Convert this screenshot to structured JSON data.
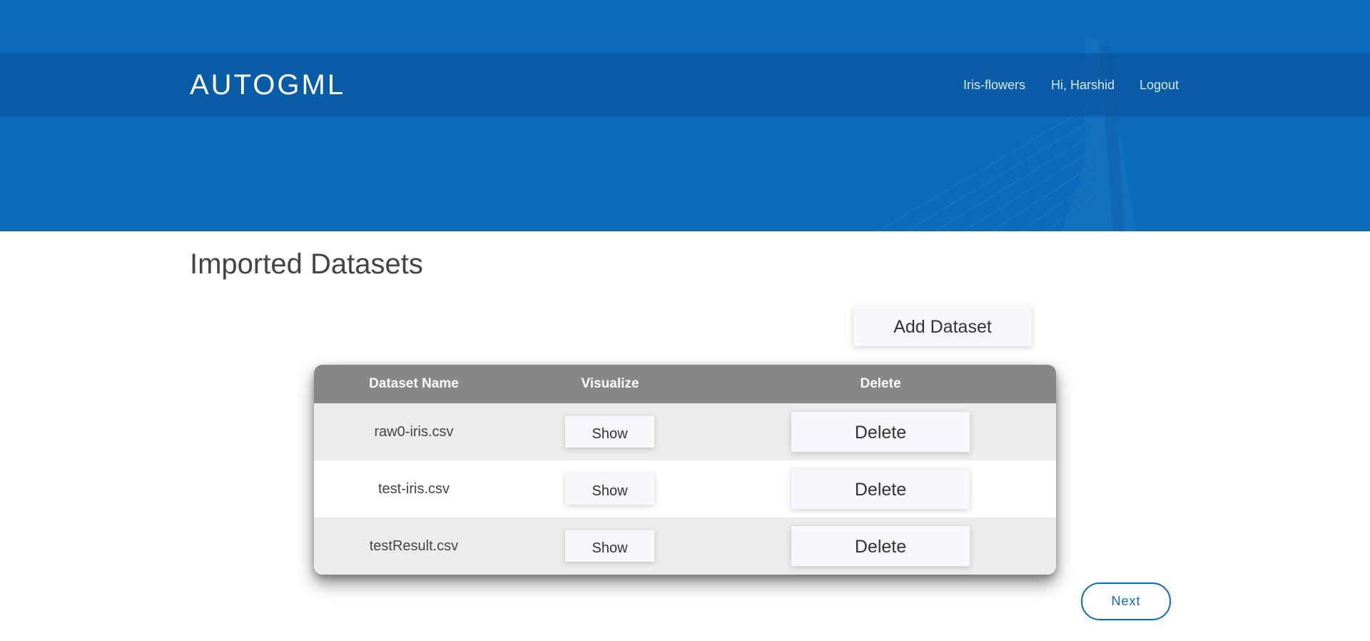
{
  "header": {
    "brand": "AUTOGML",
    "nav": [
      {
        "label": "Iris-flowers"
      },
      {
        "label": "Hi, Harshid"
      },
      {
        "label": "Logout"
      }
    ]
  },
  "main": {
    "title": "Imported Datasets",
    "add_button": "Add Dataset",
    "table": {
      "columns": [
        "Dataset Name",
        "Visualize",
        "Delete"
      ],
      "rows": [
        {
          "name": "raw0-iris.csv",
          "visualize": "Show",
          "delete": "Delete"
        },
        {
          "name": "test-iris.csv",
          "visualize": "Show",
          "delete": "Delete"
        },
        {
          "name": "testResult.csv",
          "visualize": "Show",
          "delete": "Delete"
        }
      ]
    },
    "next_button": "Next"
  },
  "colors": {
    "brand_blue": "#0b6bbb",
    "table_header": "#878787",
    "row_alt": "#ececec"
  }
}
